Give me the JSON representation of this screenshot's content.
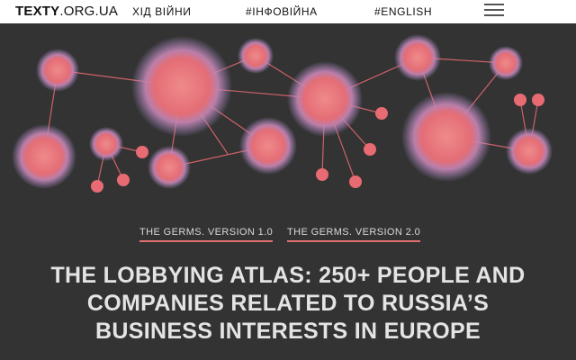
{
  "header": {
    "logo_main": "TEXTY",
    "logo_rest": ".ORG.UA",
    "nav": [
      {
        "label": "ХІД ВІЙНИ"
      },
      {
        "label": "#ІНФОВІЙНА"
      },
      {
        "label": "#ENGLISH"
      }
    ],
    "menu_icon": "hamburger-menu-icon"
  },
  "hero": {
    "colors": {
      "background": "#333333",
      "node": "#e86a72",
      "glow": "#b79ad6",
      "edge": "#e86a72"
    }
  },
  "versions": [
    {
      "label": "THE GERMS. VERSION 1.0"
    },
    {
      "label": "THE GERMS. VERSION 2.0"
    }
  ],
  "headline": {
    "line1": "THE LOBBYING ATLAS: 250+ PEOPLE AND",
    "line2": "COMPANIES RELATED TO RUSSIA’S",
    "line3": "BUSINESS INTERESTS IN EUROPE"
  }
}
